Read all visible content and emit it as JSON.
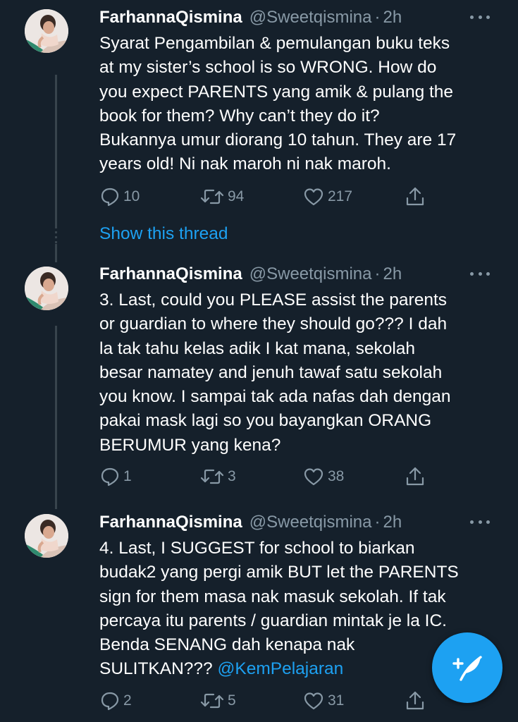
{
  "tweets": [
    {
      "name": "FarhannaQismina",
      "handle": "@Sweetqismina",
      "separator": "·",
      "time": "2h",
      "lines": [
        "Syarat Pengambilan & pemulangan buku teks",
        "at my sister’s school is so WRONG. How do",
        "you expect PARENTS yang amik & pulang the",
        "book for them? Why can’t they do it?",
        "Bukannya umur diorang 10 tahun. They are 17",
        "years old! Ni nak maroh ni nak maroh."
      ],
      "replies": "10",
      "retweets": "94",
      "likes": "217"
    },
    {
      "name": "FarhannaQismina",
      "handle": "@Sweetqismina",
      "separator": "·",
      "time": "2h",
      "lines": [
        "3. Last, could you PLEASE assist the parents",
        "or guardian to where they should go??? I dah",
        "la tak tahu kelas adik I kat mana, sekolah",
        "besar namatey and jenuh tawaf satu sekolah",
        "you know. I sampai tak ada nafas dah dengan",
        "pakai mask lagi so you bayangkan ORANG",
        "BERUMUR yang kena?"
      ],
      "replies": "1",
      "retweets": "3",
      "likes": "38"
    },
    {
      "name": "FarhannaQismina",
      "handle": "@Sweetqismina",
      "separator": "·",
      "time": "2h",
      "lines": [
        "4. Last, I SUGGEST for school to biarkan",
        "budak2 yang pergi amik BUT let the PARENTS",
        "sign for them masa nak masuk sekolah. If tak",
        "percaya itu parents / guardian mintak je la IC.",
        "Benda SENANG dah kenapa nak",
        "SULITKAN??? "
      ],
      "mention": "@KemPelajaran",
      "replies": "2",
      "retweets": "5",
      "likes": "31"
    }
  ],
  "show_thread": "Show this thread",
  "icons": {
    "reply": "reply-icon",
    "retweet": "retweet-icon",
    "like": "like-icon",
    "share": "share-icon",
    "more": "more-icon",
    "compose": "compose-tweet-icon"
  },
  "colors": {
    "background": "#15202b",
    "text": "#ffffff",
    "secondary": "#8899a6",
    "accent": "#1da1f2",
    "thread_line": "#38444d"
  }
}
